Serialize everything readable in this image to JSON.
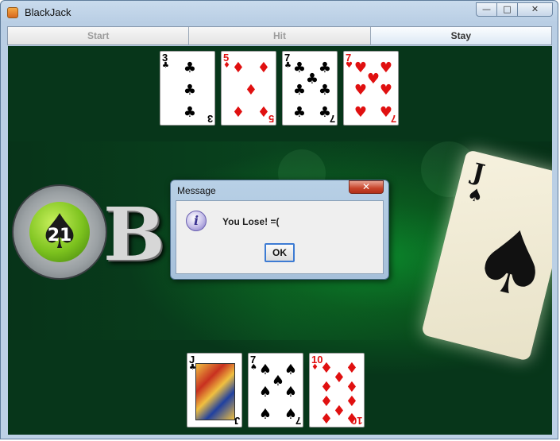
{
  "window": {
    "title": "BlackJack",
    "minimize_glyph": "—",
    "maximize_glyph": "□",
    "close_glyph": "✕"
  },
  "toolbar": {
    "buttons": [
      {
        "label": "Start",
        "enabled": false
      },
      {
        "label": "Hit",
        "enabled": false
      },
      {
        "label": "Stay",
        "enabled": true
      }
    ]
  },
  "background_logo": {
    "number": "21",
    "text": "BL      K",
    "big_card_rank": "J",
    "big_card_suit": "♠"
  },
  "dealer_hand": [
    {
      "rank": "3",
      "suit": "♣",
      "color": "black"
    },
    {
      "rank": "5",
      "suit": "♦",
      "color": "red"
    },
    {
      "rank": "7",
      "suit": "♣",
      "color": "black"
    },
    {
      "rank": "7",
      "suit": "♥",
      "color": "red"
    }
  ],
  "player_hand": [
    {
      "rank": "J",
      "suit": "♣",
      "color": "black",
      "face": true
    },
    {
      "rank": "7",
      "suit": "♠",
      "color": "black"
    },
    {
      "rank": "10",
      "suit": "♦",
      "color": "red"
    }
  ],
  "dialog": {
    "title": "Message",
    "close_glyph": "✕",
    "icon": "info-icon",
    "icon_glyph": "i",
    "message": "You Lose! =(",
    "ok_label": "OK"
  },
  "colors": {
    "felt": "#0a5a1f",
    "red_suit": "#e01010",
    "black_suit": "#000000",
    "ok_focus": "#3d7bd3"
  }
}
